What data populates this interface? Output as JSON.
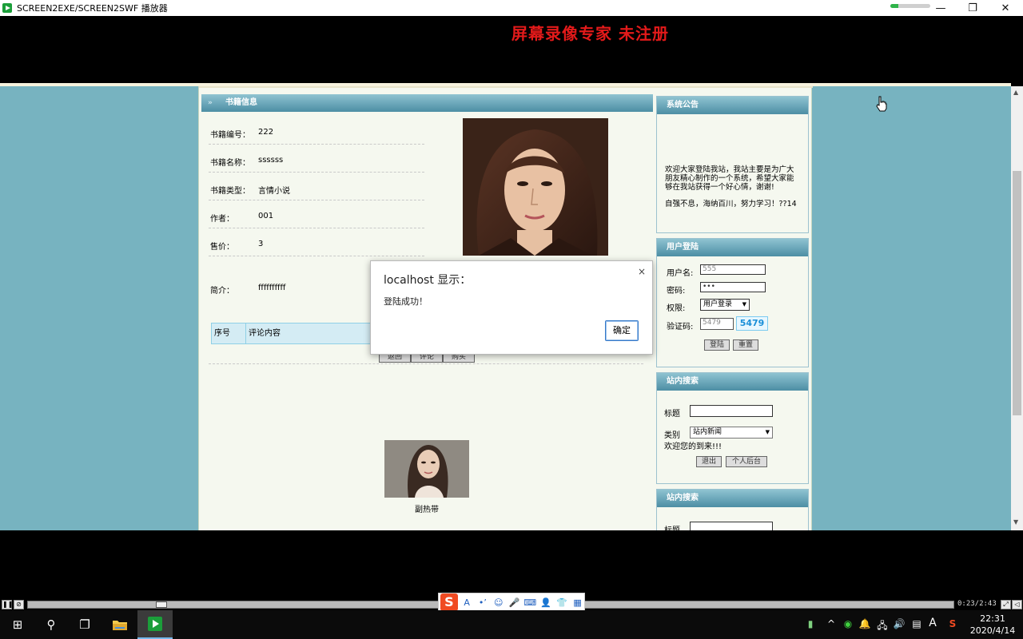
{
  "window": {
    "title": "SCREEN2EXE/SCREEN2SWF 播放器",
    "minimize_glyph": "—",
    "maximize_glyph": "❐",
    "close_glyph": "✕",
    "progress_fraction": 0.2
  },
  "watermark": {
    "text": "屏幕录像专家  未注册"
  },
  "book_info": {
    "header": "书籍信息",
    "rows": [
      {
        "label": "书籍编号：",
        "value": "222"
      },
      {
        "label": "书籍名称：",
        "value": "ssssss"
      },
      {
        "label": "书籍类型：",
        "value": "言情小说"
      },
      {
        "label": "作者：",
        "value": "001"
      },
      {
        "label": "售价：",
        "value": "3"
      },
      {
        "label": "简介：",
        "value": "ffffffffff"
      }
    ],
    "comment_table": {
      "col_index": "序号",
      "col_content": "评论内容"
    },
    "buttons": [
      "返回",
      "评论",
      "购买"
    ],
    "thumbnail_caption": "副热带"
  },
  "announcement": {
    "header": "系统公告",
    "text": "欢迎大家登陆我站，我站主要是为广大朋友精心制作的一个系统，希望大家能够在我站获得一个好心情，谢谢!",
    "motto": "自强不息，海纳百川，努力学习！??14"
  },
  "login": {
    "header": "用户登陆",
    "username_label": "用户名:",
    "username_value": "555",
    "password_label": "密码:",
    "password_value": "•••",
    "role_label": "权限:",
    "role_value": "用户登录",
    "captcha_label": "验证码:",
    "captcha_input": "5479",
    "captcha_image": "5479",
    "login_btn": "登陆",
    "reset_btn": "重置"
  },
  "search1": {
    "header": "站内搜索",
    "title_label": "标题",
    "category_label": "类别",
    "category_value": "站内新闻",
    "welcome": "欢迎您的到来!!!",
    "logout_btn": "退出",
    "backend_btn": "个人后台"
  },
  "search2": {
    "header": "站内搜索",
    "title_label": "标题"
  },
  "dialog": {
    "title": "localhost 显示：",
    "message": "登陆成功！",
    "ok": "确定",
    "close_glyph": "×"
  },
  "player": {
    "pause_glyph": "❚❚",
    "stop_glyph": "⊘",
    "time": "0:23/2:43",
    "progress_fraction": 0.14
  },
  "ime": {
    "logo": "S",
    "icons": [
      "A",
      "•ʼ",
      "☺",
      "🎤",
      "⌨",
      "👤",
      "👕",
      "▦"
    ]
  },
  "taskbar": {
    "start_glyph": "⊞",
    "search_glyph": "⚲",
    "taskview_glyph": "❐",
    "tray": [
      "▮",
      "^",
      "◉",
      "🔔",
      "🖧",
      "🔊",
      "▤",
      "A",
      "S"
    ],
    "time": "22:31",
    "date": "2020/4/14"
  }
}
